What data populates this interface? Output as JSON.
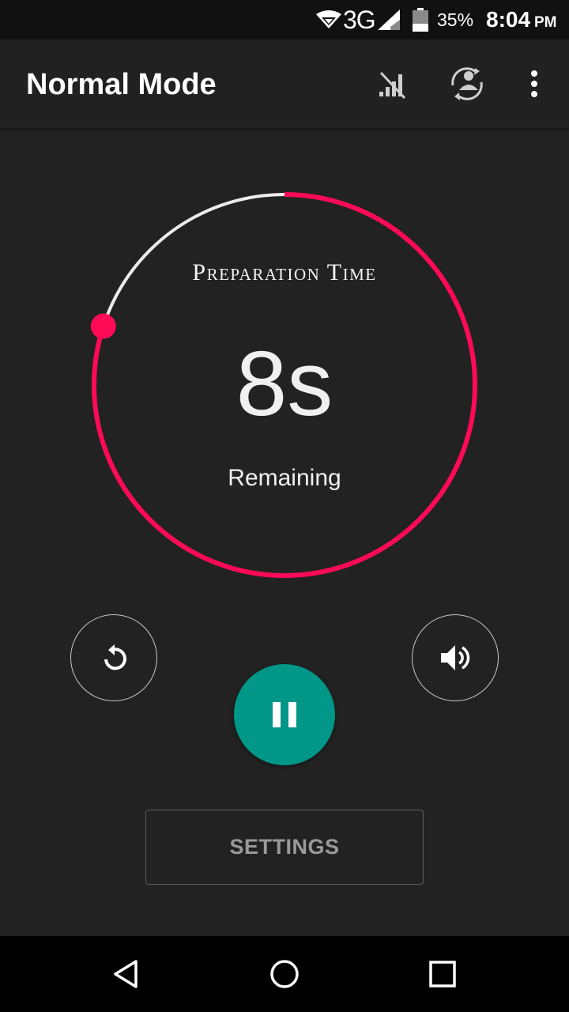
{
  "status_bar": {
    "network": "3G",
    "battery": "35%",
    "time": "8:04",
    "ampm": "PM",
    "icons": [
      "wifi-icon",
      "signal-icon",
      "battery-icon"
    ]
  },
  "app_bar": {
    "title": "Normal Mode",
    "actions": [
      "no-signal-icon",
      "rotate-person-icon",
      "more-vert-icon"
    ]
  },
  "timer": {
    "label": "Preparation Time",
    "value": "8s",
    "sublabel": "Remaining",
    "progress_remaining_fraction": 0.8
  },
  "controls": {
    "left": "restart-icon",
    "center": "pause-icon",
    "right": "volume-icon"
  },
  "settings": {
    "label": "SETTINGS"
  },
  "colors": {
    "background": "#222222",
    "accent": "#ff0a57",
    "track": "#ececec",
    "pause": "#009688"
  },
  "nav": [
    "back-icon",
    "home-icon",
    "recents-icon"
  ]
}
